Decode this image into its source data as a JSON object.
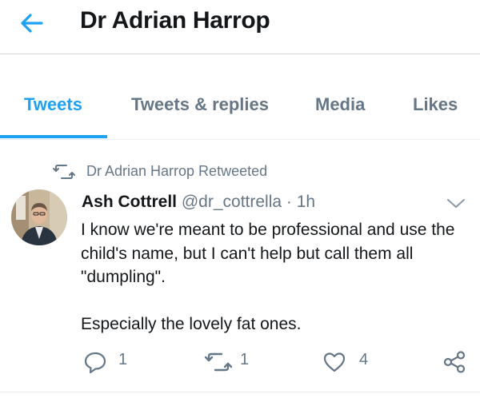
{
  "header": {
    "title": "Dr Adrian Harrop"
  },
  "tabs": [
    {
      "label": "Tweets"
    },
    {
      "label": "Tweets & replies"
    },
    {
      "label": "Media"
    },
    {
      "label": "Likes"
    }
  ],
  "tweet": {
    "retweet_note": "Dr Adrian Harrop Retweeted",
    "author_name": "Ash Cottrell",
    "handle": "@dr_cottrella",
    "time": "1h",
    "text_lines": [
      "I know we're meant to be professional and use the child's name, but I can't help but call them all \"dumpling\".",
      "Especially the lovely fat ones."
    ],
    "reply_count": "1",
    "retweet_count": "1",
    "like_count": "4"
  },
  "colors": {
    "accent": "#1da1f2",
    "muted": "#657786",
    "text": "#14171a"
  },
  "icons": [
    "back-arrow-icon",
    "retweet-icon",
    "chevron-down-icon",
    "reply-icon",
    "heart-icon",
    "share-icon"
  ]
}
